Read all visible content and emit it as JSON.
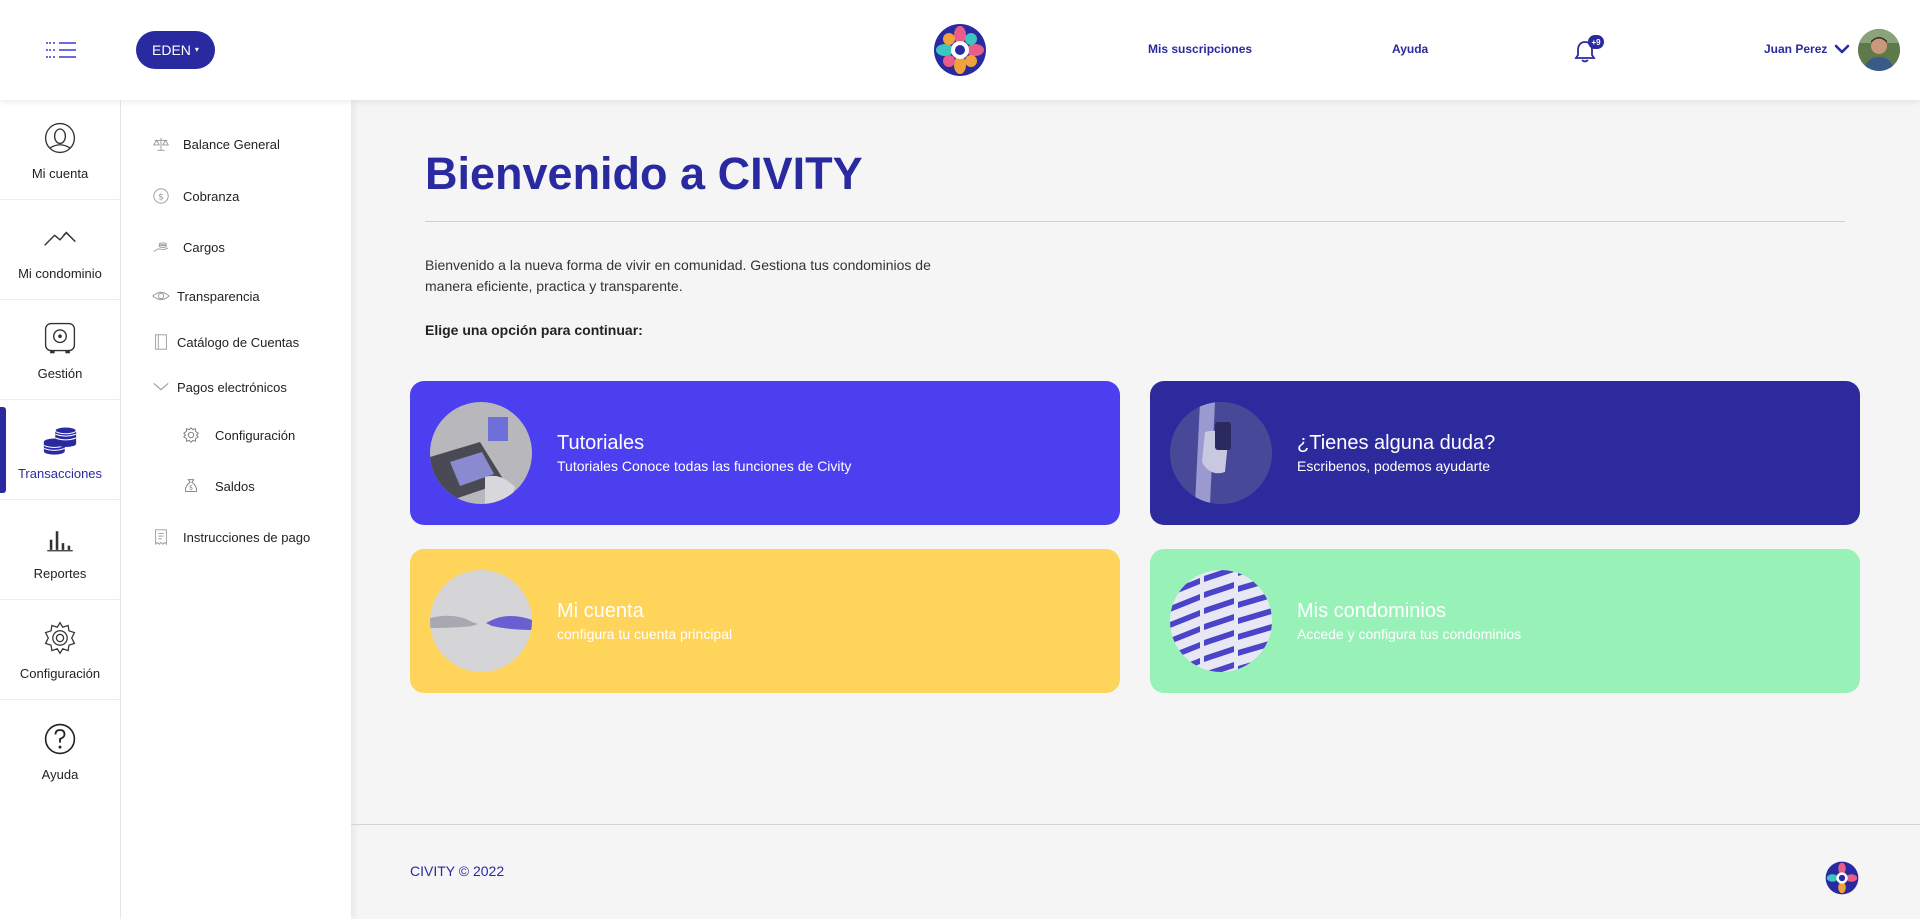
{
  "header": {
    "org_button": "EDEN",
    "nav": {
      "subscriptions": "Mis suscripciones",
      "help": "Ayuda"
    },
    "notifications_badge": "+9",
    "user_name": "Juan Perez"
  },
  "rail": {
    "items": [
      {
        "label": "Mi cuenta",
        "icon": "user-circle-icon"
      },
      {
        "label": "Mi condominio",
        "icon": "mountain-icon"
      },
      {
        "label": "Gestión",
        "icon": "safe-icon"
      },
      {
        "label": "Transacciones",
        "icon": "coins-stack-icon",
        "active": true
      },
      {
        "label": "Reportes",
        "icon": "bar-chart-icon"
      },
      {
        "label": "Configuración",
        "icon": "gear-icon"
      },
      {
        "label": "Ayuda",
        "icon": "question-circle-icon"
      }
    ]
  },
  "submenu": {
    "items": [
      {
        "label": "Balance General",
        "icon": "scale-icon"
      },
      {
        "label": "Cobranza",
        "icon": "coin-icon"
      },
      {
        "label": "Cargos",
        "icon": "hand-coins-icon"
      },
      {
        "label": "Transparencia",
        "icon": "eye-icon"
      },
      {
        "label": "Catálogo de Cuentas",
        "icon": "notebook-icon"
      },
      {
        "label": "Pagos electrónicos",
        "icon": "chevron-down-icon",
        "expanded": true
      },
      {
        "label": "Configuración",
        "icon": "gear-icon"
      },
      {
        "label": "Saldos",
        "icon": "money-bag-icon"
      },
      {
        "label": "Instrucciones de pago",
        "icon": "receipt-icon"
      }
    ]
  },
  "main": {
    "title": "Bienvenido a CIVITY",
    "intro": "Bienvenido a la nueva forma de vivir en comunidad. Gestiona tus condominios de manera eficiente, practica y transparente.",
    "choose": "Elige una opción para continuar:",
    "cards": [
      {
        "title": "Tutoriales",
        "subtitle": "Tutoriales Conoce todas las funciones de Civity",
        "color": "#4b3ff0"
      },
      {
        "title": "¿Tienes alguna duda?",
        "subtitle": "Escribenos, podemos ayudarte",
        "color": "#2d2a9e"
      },
      {
        "title": "Mi cuenta",
        "subtitle": "configura tu cuenta principal",
        "color": "#ffd45a"
      },
      {
        "title": "Mis condominios",
        "subtitle": "Accede y configura tus condominios",
        "color": "#98f2b8"
      }
    ]
  },
  "footer": {
    "copyright": "CIVITY © 2022"
  },
  "colors": {
    "brand": "#2a2aa0",
    "background": "#f5f5f5"
  }
}
